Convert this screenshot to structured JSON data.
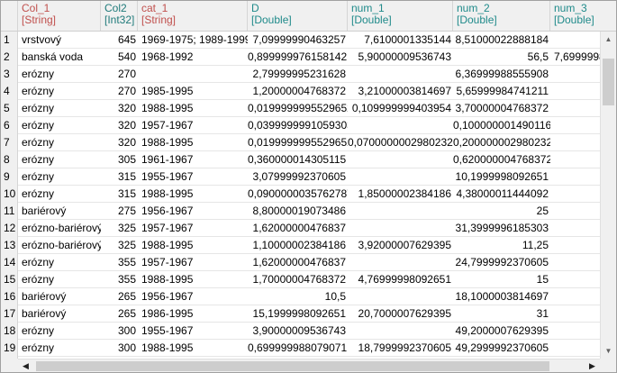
{
  "columns": [
    {
      "name": "Col_1",
      "type": "[String]"
    },
    {
      "name": "Col2",
      "type": "[Int32]"
    },
    {
      "name": "cat_1",
      "type": "[String]"
    },
    {
      "name": "D",
      "type": "[Double]"
    },
    {
      "name": "num_1",
      "type": "[Double]"
    },
    {
      "name": "num_2",
      "type": "[Double]"
    },
    {
      "name": "num_3",
      "type": "[Double]"
    }
  ],
  "rows": [
    {
      "n": "1",
      "col1": "vrstvový",
      "col2": "645",
      "cat1": "1969-1975; 1989-1999",
      "d": "7,09999990463257",
      "num1": "7,6100001335144",
      "num2": "8,51000022888184",
      "num3": ""
    },
    {
      "n": "2",
      "col1": "banská voda",
      "col2": "540",
      "cat1": "1968-1992",
      "d": "0,899999976158142",
      "num1": "5,90000009536743",
      "num2": "56,5",
      "num3": "7,6999998"
    },
    {
      "n": "3",
      "col1": "erózny",
      "col2": "270",
      "cat1": "",
      "d": "2,79999995231628",
      "num1": "",
      "num2": "6,36999988555908",
      "num3": ""
    },
    {
      "n": "4",
      "col1": "erózny",
      "col2": "270",
      "cat1": "1985-1995",
      "d": "1,20000004768372",
      "num1": "3,21000003814697",
      "num2": "5,65999984741211",
      "num3": ""
    },
    {
      "n": "5",
      "col1": "erózny",
      "col2": "320",
      "cat1": "1988-1995",
      "d": "0,0199999995529652",
      "num1": "0,109999999403954",
      "num2": "3,70000004768372",
      "num3": ""
    },
    {
      "n": "6",
      "col1": "erózny",
      "col2": "320",
      "cat1": "1957-1967",
      "d": "0,0399999991059303",
      "num1": "",
      "num2": "0,100000001490116",
      "num3": ""
    },
    {
      "n": "7",
      "col1": "erózny",
      "col2": "320",
      "cat1": "1988-1995",
      "d": "0,0199999995529652",
      "num1": "0,0700000002980232",
      "num2": "0,200000002980232",
      "num3": ""
    },
    {
      "n": "8",
      "col1": "erózny",
      "col2": "305",
      "cat1": "1961-1967",
      "d": "0,360000014305115",
      "num1": "",
      "num2": "0,620000004768372",
      "num3": ""
    },
    {
      "n": "9",
      "col1": "erózny",
      "col2": "315",
      "cat1": "1955-1967",
      "d": "3,07999992370605",
      "num1": "",
      "num2": "10,1999998092651",
      "num3": ""
    },
    {
      "n": "10",
      "col1": "erózny",
      "col2": "315",
      "cat1": "1988-1995",
      "d": "0,0900000035762787",
      "num1": "1,85000002384186",
      "num2": "4,38000011444092",
      "num3": ""
    },
    {
      "n": "11",
      "col1": "bariérový",
      "col2": "275",
      "cat1": "1956-1967",
      "d": "8,80000019073486",
      "num1": "",
      "num2": "25",
      "num3": ""
    },
    {
      "n": "12",
      "col1": "erózno-bariérový",
      "col2": "325",
      "cat1": "1957-1967",
      "d": "1,62000000476837",
      "num1": "",
      "num2": "31,3999996185303",
      "num3": ""
    },
    {
      "n": "13",
      "col1": "erózno-bariérový",
      "col2": "325",
      "cat1": "1988-1995",
      "d": "1,10000002384186",
      "num1": "3,92000007629395",
      "num2": "11,25",
      "num3": ""
    },
    {
      "n": "14",
      "col1": "erózny",
      "col2": "355",
      "cat1": "1957-1967",
      "d": "1,62000000476837",
      "num1": "",
      "num2": "24,7999992370605",
      "num3": ""
    },
    {
      "n": "15",
      "col1": "erózny",
      "col2": "355",
      "cat1": "1988-1995",
      "d": "1,70000004768372",
      "num1": "4,76999998092651",
      "num2": "15",
      "num3": ""
    },
    {
      "n": "16",
      "col1": "bariérový",
      "col2": "265",
      "cat1": "1956-1967",
      "d": "10,5",
      "num1": "",
      "num2": "18,1000003814697",
      "num3": ""
    },
    {
      "n": "17",
      "col1": "bariérový",
      "col2": "265",
      "cat1": "1986-1995",
      "d": "15,1999998092651",
      "num1": "20,7000007629395",
      "num2": "31",
      "num3": ""
    },
    {
      "n": "18",
      "col1": "erózny",
      "col2": "300",
      "cat1": "1955-1967",
      "d": "3,90000009536743",
      "num1": "",
      "num2": "49,2000007629395",
      "num3": ""
    },
    {
      "n": "19",
      "col1": "erózny",
      "col2": "300",
      "cat1": "1988-1995",
      "d": "0,699999988079071",
      "num1": "18,7999992370605",
      "num2": "49,2999992370605",
      "num3": ""
    },
    {
      "n": "20",
      "col1": "bariérový",
      "col2": "215",
      "cat1": "1956-1970",
      "d": "0,699999988079071",
      "num1": "",
      "num2": "21",
      "num3": ""
    }
  ],
  "scroll_icons": {
    "up": "▲",
    "down": "▼",
    "left": "◀",
    "right": "▶"
  }
}
